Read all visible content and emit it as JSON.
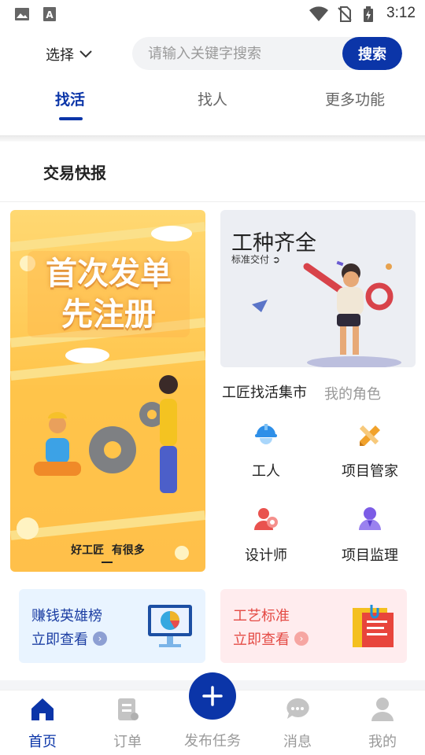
{
  "status_bar": {
    "time": "3:12",
    "icons": [
      "image-icon",
      "a-icon",
      "wifi-icon",
      "no-sim-icon",
      "battery-charging-icon"
    ]
  },
  "header": {
    "select_label": "选择",
    "search": {
      "placeholder": "请输入关键字搜索",
      "button_label": "搜索"
    },
    "tabs": [
      {
        "label": "找活",
        "active": true
      },
      {
        "label": "找人"
      },
      {
        "label": "更多功能"
      }
    ]
  },
  "news": {
    "title": "交易快报"
  },
  "promo": {
    "headline_line1": "首次发单",
    "headline_line2": "先注册",
    "footer": "好工匠  有很多"
  },
  "crafts_card": {
    "title": "工种齐全",
    "subtitle": "标准交付"
  },
  "market": {
    "title": "工匠找活集市",
    "my_role": "我的角色",
    "roles": [
      {
        "label": "工人",
        "icon": "hard-hat-worker-icon"
      },
      {
        "label": "项目管家",
        "icon": "ruler-pencil-icon"
      },
      {
        "label": "设计师",
        "icon": "designer-icon"
      },
      {
        "label": "项目监理",
        "icon": "supervisor-icon"
      }
    ]
  },
  "banners": [
    {
      "title": "赚钱英雄榜",
      "action": "立即查看",
      "icon": "chart-monitor-icon"
    },
    {
      "title": "工艺标准",
      "action": "立即查看",
      "icon": "clipboard-note-icon"
    }
  ],
  "bottom_nav": [
    {
      "label": "首页",
      "icon": "home-icon",
      "active": true
    },
    {
      "label": "订单",
      "icon": "orders-icon"
    },
    {
      "label": "发布任务",
      "icon": "plus-icon"
    },
    {
      "label": "消息",
      "icon": "chat-icon"
    },
    {
      "label": "我的",
      "icon": "user-icon"
    }
  ],
  "colors": {
    "brand": "#0b35a8",
    "promo_bg": "#ffc44a",
    "hero_bg": "#e9f4ff",
    "craft_bg": "#ffecee",
    "craft_text": "#e44b45"
  }
}
